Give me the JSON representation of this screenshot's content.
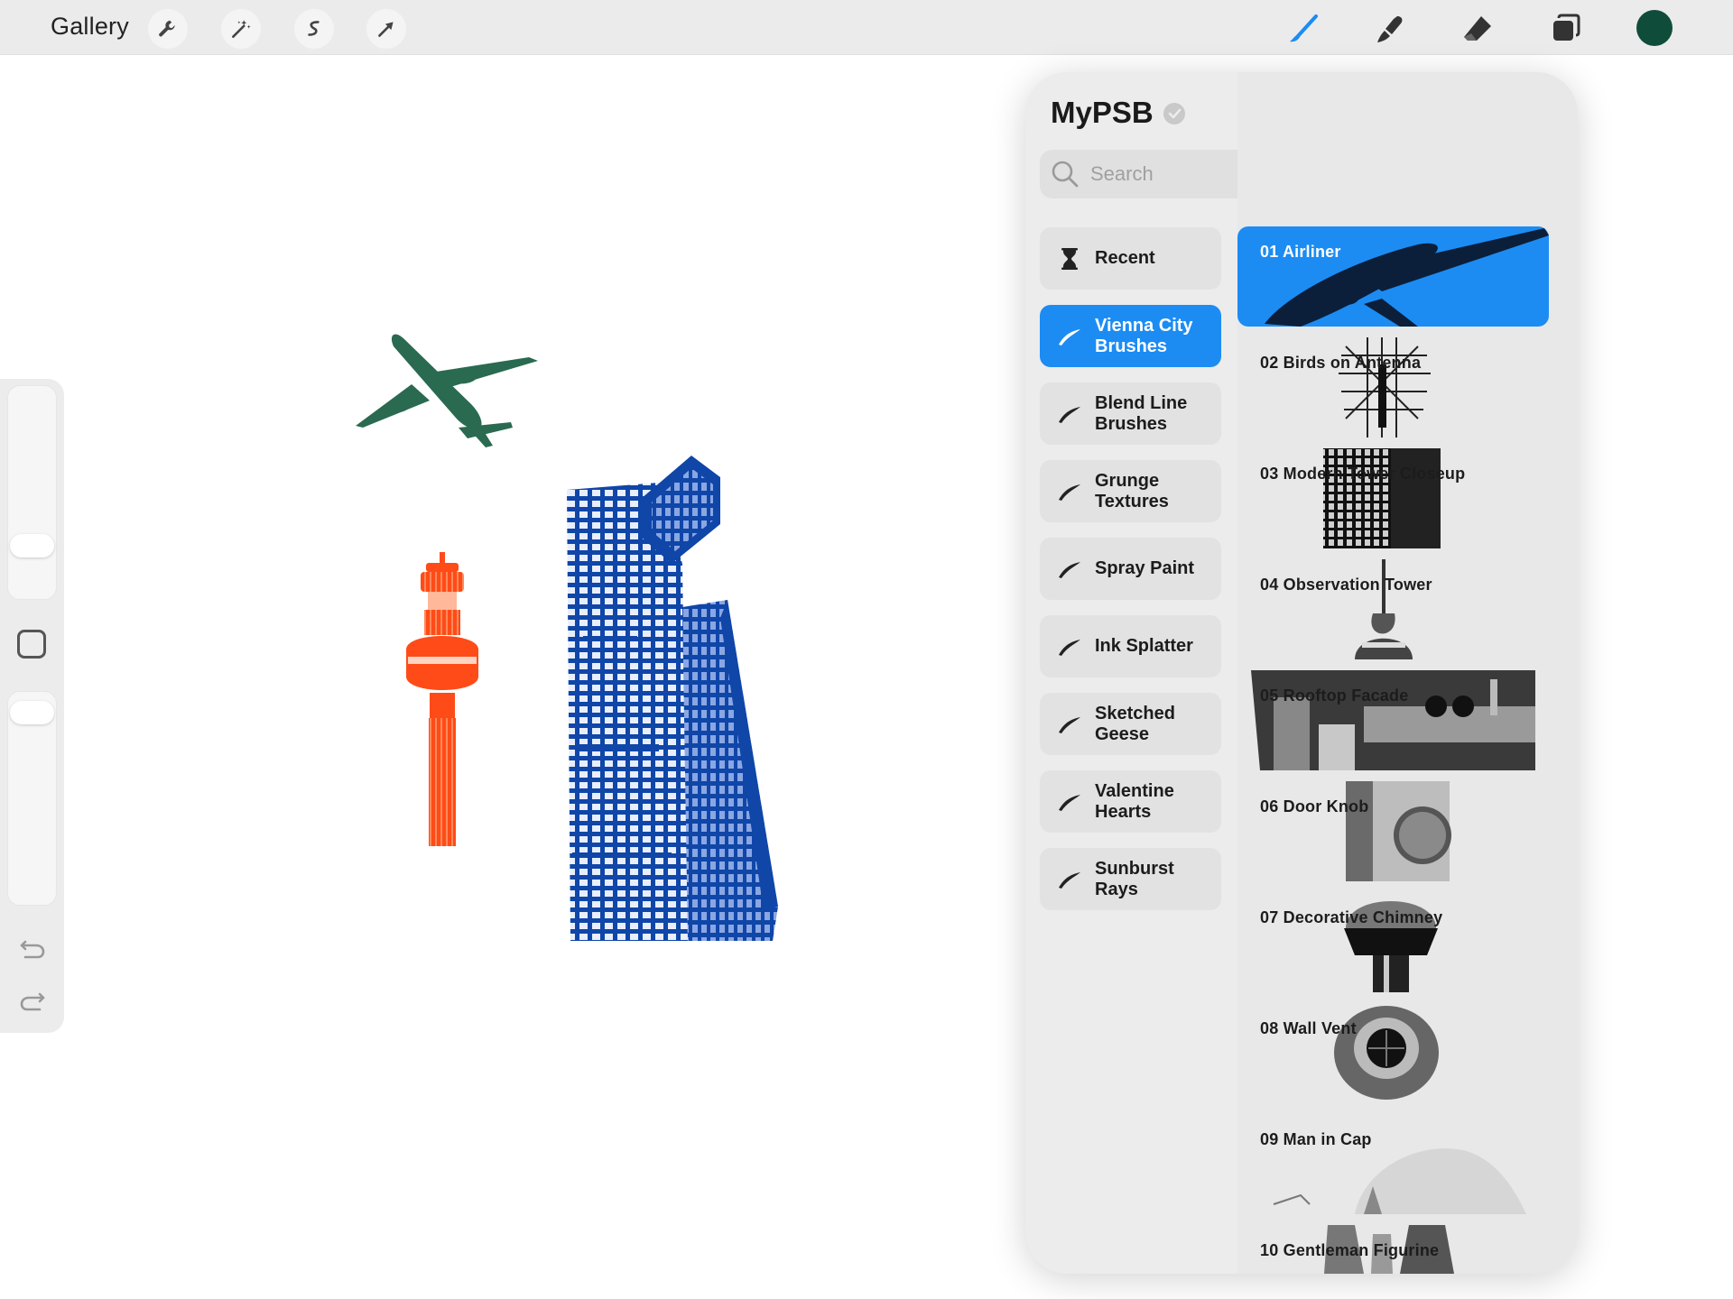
{
  "toolbar": {
    "gallery_label": "Gallery",
    "left_tools": [
      {
        "name": "actions-wrench-icon"
      },
      {
        "name": "adjustments-magic-wand-icon"
      },
      {
        "name": "selection-s-icon"
      },
      {
        "name": "transform-arrow-icon"
      }
    ],
    "right_tools": [
      {
        "name": "brush-icon"
      },
      {
        "name": "smudge-icon"
      },
      {
        "name": "eraser-icon"
      },
      {
        "name": "layers-icon"
      }
    ],
    "current_color": "#0f4d3a"
  },
  "sidebar": {
    "icons": [
      "brush-size-slider",
      "modify-square-icon",
      "opacity-slider",
      "undo-icon",
      "redo-icon"
    ]
  },
  "canvas": {
    "colors": {
      "plane": "#2a6a50",
      "tower": "#ff4b18",
      "building": "#0f46a8"
    }
  },
  "brush_library": {
    "title": "MyPSB",
    "search_placeholder": "Search",
    "accent": "#1c8cf3",
    "sets": [
      {
        "label": "Recent",
        "icon": "hourglass-icon",
        "active": false
      },
      {
        "label": "Vienna City Brushes",
        "icon": "brush-stroke-icon",
        "active": true
      },
      {
        "label": "Blend Line Brushes",
        "icon": "brush-stroke-icon",
        "active": false
      },
      {
        "label": "Grunge Textures",
        "icon": "brush-stroke-icon",
        "active": false
      },
      {
        "label": "Spray Paint",
        "icon": "brush-stroke-icon",
        "active": false
      },
      {
        "label": "Ink Splatter",
        "icon": "brush-stroke-icon",
        "active": false
      },
      {
        "label": "Sketched Geese",
        "icon": "brush-stroke-icon",
        "active": false
      },
      {
        "label": "Valentine Hearts",
        "icon": "brush-stroke-icon",
        "active": false
      },
      {
        "label": "Sunburst Rays",
        "icon": "brush-stroke-icon",
        "active": false
      }
    ],
    "brushes": [
      {
        "label": "01 Airliner",
        "active": true
      },
      {
        "label": "02 Birds on Antenna",
        "active": false
      },
      {
        "label": "03 Modern Tower Closeup",
        "active": false
      },
      {
        "label": "04 Observation Tower",
        "active": false
      },
      {
        "label": "05 Rooftop Facade",
        "active": false
      },
      {
        "label": "06 Door Knob",
        "active": false
      },
      {
        "label": "07 Decorative Chimney",
        "active": false
      },
      {
        "label": "08 Wall Vent",
        "active": false
      },
      {
        "label": "09 Man in Cap",
        "active": false
      },
      {
        "label": "10 Gentleman Figurine",
        "active": false
      }
    ]
  }
}
